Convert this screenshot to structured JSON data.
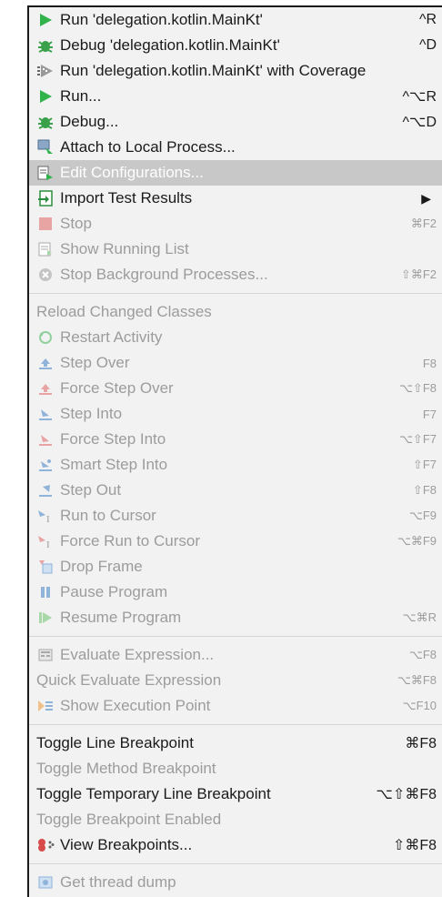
{
  "menu": {
    "items": [
      {
        "label": "Run 'delegation.kotlin.MainKt'",
        "shortcut": "^R",
        "icon": "run-icon",
        "enabled": true
      },
      {
        "label": "Debug 'delegation.kotlin.MainKt'",
        "shortcut": "^D",
        "icon": "debug-icon",
        "enabled": true
      },
      {
        "label": "Run 'delegation.kotlin.MainKt' with Coverage",
        "shortcut": "",
        "icon": "coverage-icon",
        "enabled": true
      },
      {
        "label": "Run...",
        "shortcut": "^⌥R",
        "icon": "run-icon",
        "enabled": true
      },
      {
        "label": "Debug...",
        "shortcut": "^⌥D",
        "icon": "debug-icon",
        "enabled": true
      },
      {
        "label": "Attach to Local Process...",
        "shortcut": "",
        "icon": "attach-icon",
        "enabled": true
      },
      {
        "label": "Edit Configurations...",
        "shortcut": "",
        "icon": "edit-config-icon",
        "enabled": true,
        "selected": true
      },
      {
        "label": "Import Test Results",
        "shortcut": "▶",
        "icon": "import-icon",
        "enabled": true,
        "submenu": true
      },
      {
        "label": "Stop",
        "shortcut": "⌘F2",
        "icon": "stop-icon",
        "enabled": false
      },
      {
        "label": "Show Running List",
        "shortcut": "",
        "icon": "list-icon",
        "enabled": false
      },
      {
        "label": "Stop Background Processes...",
        "shortcut": "⇧⌘F2",
        "icon": "stop-bg-icon",
        "enabled": false
      }
    ],
    "group2": [
      {
        "label": "Reload Changed Classes",
        "shortcut": "",
        "icon": "",
        "enabled": false
      },
      {
        "label": "Restart Activity",
        "shortcut": "",
        "icon": "restart-icon",
        "enabled": false
      },
      {
        "label": "Step Over",
        "shortcut": "F8",
        "icon": "step-over-icon",
        "enabled": false
      },
      {
        "label": "Force Step Over",
        "shortcut": "⌥⇧F8",
        "icon": "force-step-over-icon",
        "enabled": false
      },
      {
        "label": "Step Into",
        "shortcut": "F7",
        "icon": "step-into-icon",
        "enabled": false
      },
      {
        "label": "Force Step Into",
        "shortcut": "⌥⇧F7",
        "icon": "force-step-into-icon",
        "enabled": false
      },
      {
        "label": "Smart Step Into",
        "shortcut": "⇧F7",
        "icon": "smart-step-into-icon",
        "enabled": false
      },
      {
        "label": "Step Out",
        "shortcut": "⇧F8",
        "icon": "step-out-icon",
        "enabled": false
      },
      {
        "label": "Run to Cursor",
        "shortcut": "⌥F9",
        "icon": "run-to-cursor-icon",
        "enabled": false
      },
      {
        "label": "Force Run to Cursor",
        "shortcut": "⌥⌘F9",
        "icon": "force-run-to-cursor-icon",
        "enabled": false
      },
      {
        "label": "Drop Frame",
        "shortcut": "",
        "icon": "drop-frame-icon",
        "enabled": false
      },
      {
        "label": "Pause Program",
        "shortcut": "",
        "icon": "pause-icon",
        "enabled": false
      },
      {
        "label": "Resume Program",
        "shortcut": "⌥⌘R",
        "icon": "resume-icon",
        "enabled": false
      }
    ],
    "group3": [
      {
        "label": "Evaluate Expression...",
        "shortcut": "⌥F8",
        "icon": "evaluate-icon",
        "enabled": false
      },
      {
        "label": "Quick Evaluate Expression",
        "shortcut": "⌥⌘F8",
        "icon": "",
        "enabled": false
      },
      {
        "label": "Show Execution Point",
        "shortcut": "⌥F10",
        "icon": "exec-point-icon",
        "enabled": false
      }
    ],
    "group4": [
      {
        "label": "Toggle Line Breakpoint",
        "shortcut": "⌘F8",
        "icon": "",
        "enabled": true
      },
      {
        "label": "Toggle Method Breakpoint",
        "shortcut": "",
        "icon": "",
        "enabled": false
      },
      {
        "label": "Toggle Temporary Line Breakpoint",
        "shortcut": "⌥⇧⌘F8",
        "icon": "",
        "enabled": true
      },
      {
        "label": "Toggle Breakpoint Enabled",
        "shortcut": "",
        "icon": "",
        "enabled": false
      },
      {
        "label": "View Breakpoints...",
        "shortcut": "⇧⌘F8",
        "icon": "breakpoints-icon",
        "enabled": true
      }
    ],
    "group5": [
      {
        "label": "Get thread dump",
        "shortcut": "",
        "icon": "thread-dump-icon",
        "enabled": false
      }
    ]
  },
  "colors": {
    "menu_bg": "#f2f2f2",
    "selected_bg": "#c8c8c8",
    "disabled_text": "#9c9c9c",
    "run_green": "#2fb34a",
    "debug_green": "#3aa14a",
    "breakpoint_red": "#d84b4b"
  }
}
